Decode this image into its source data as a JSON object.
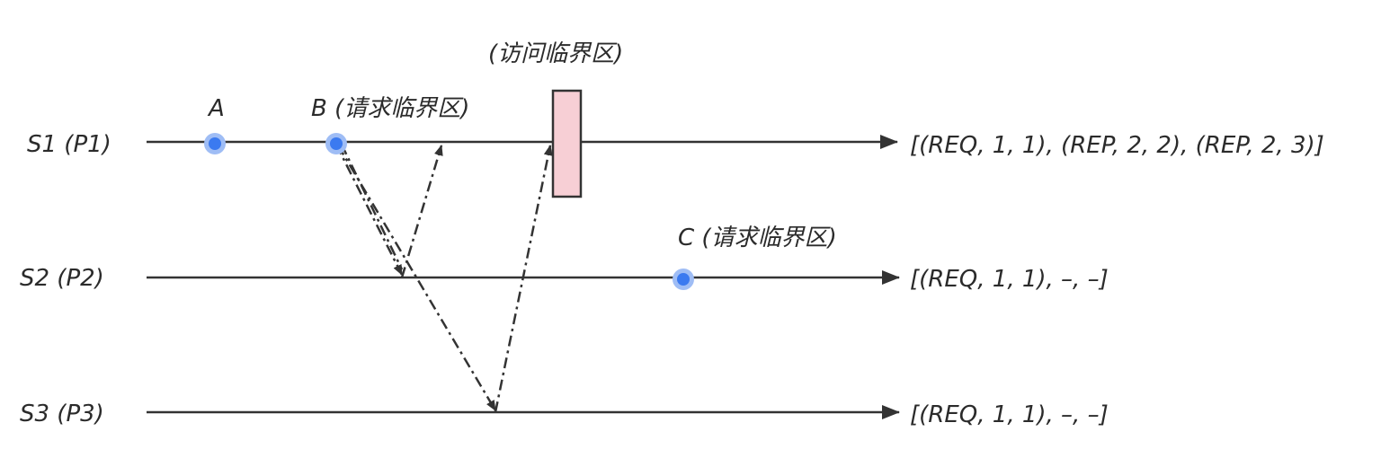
{
  "processes": [
    {
      "label": "S1 (P1)",
      "state": "[(REQ, 1, 1), (REP, 2, 2), (REP, 2, 3)]"
    },
    {
      "label": "S2 (P2)",
      "state": "[(REQ, 1, 1), –, –]"
    },
    {
      "label": "S3 (P3)",
      "state": "[(REQ, 1, 1), –, –]"
    }
  ],
  "events": {
    "a": {
      "label": "A"
    },
    "b": {
      "label": "B (请求临界区)"
    },
    "c": {
      "label": "C (请求临界区)"
    }
  },
  "critical_section": {
    "label": "(访问临界区)"
  },
  "colors": {
    "line": "#333333",
    "event_dot": "#3b7af0",
    "event_halo": "#9fbdf5",
    "critical_fill": "#f7cfd5",
    "critical_stroke": "#333333"
  }
}
